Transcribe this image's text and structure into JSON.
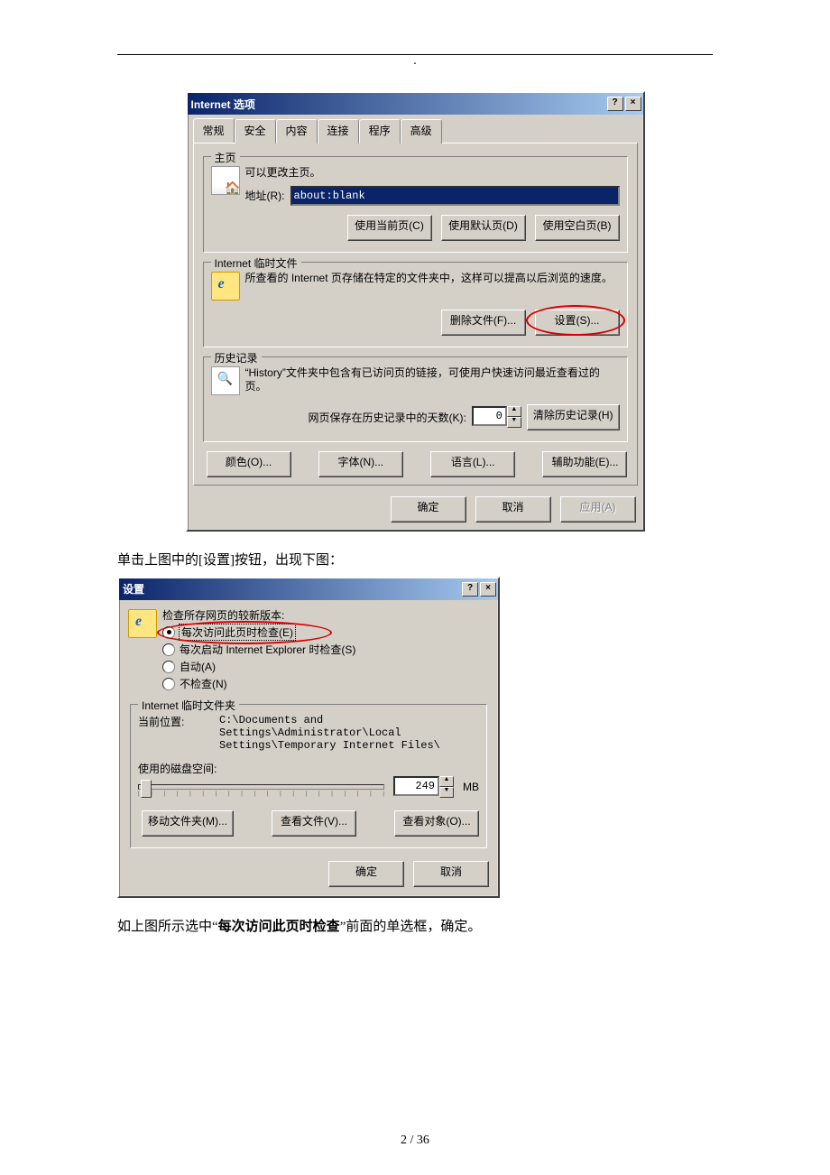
{
  "dialog1": {
    "title": "Internet 选项",
    "tabs": [
      "常规",
      "安全",
      "内容",
      "连接",
      "程序",
      "高级"
    ],
    "home": {
      "legend": "主页",
      "desc": "可以更改主页。",
      "address_label": "地址(R):",
      "address_value": "about:blank",
      "btn_current": "使用当前页(C)",
      "btn_default": "使用默认页(D)",
      "btn_blank": "使用空白页(B)"
    },
    "temp": {
      "legend": "Internet 临时文件",
      "desc": "所查看的 Internet 页存储在特定的文件夹中，这样可以提高以后浏览的速度。",
      "btn_delete": "删除文件(F)...",
      "btn_settings": "设置(S)..."
    },
    "history": {
      "legend": "历史记录",
      "desc": "“History”文件夹中包含有已访问页的链接，可使用户快速访问最近查看过的页。",
      "days_label": "网页保存在历史记录中的天数(K):",
      "days_value": "0",
      "btn_clear": "清除历史记录(H)"
    },
    "bottom_row": {
      "colors": "颜色(O)...",
      "fonts": "字体(N)...",
      "languages": "语言(L)...",
      "accessibility": "辅助功能(E)..."
    },
    "footer": {
      "ok": "确定",
      "cancel": "取消",
      "apply": "应用(A)"
    }
  },
  "caption1": "单击上图中的[设置]按钮，出现下图：",
  "dialog2": {
    "title": "设置",
    "check_group_label": "检查所存网页的较新版本:",
    "radios": {
      "r1": "每次访问此页时检查(E)",
      "r2": "每次启动 Internet Explorer 时检查(S)",
      "r3": "自动(A)",
      "r4": "不检查(N)"
    },
    "folder": {
      "legend": "Internet 临时文件夹",
      "loc_label": "当前位置:",
      "loc_value": "C:\\Documents and\nSettings\\Administrator\\Local\nSettings\\Temporary Internet Files\\",
      "disk_label": "使用的磁盘空间:",
      "disk_value": "249",
      "disk_unit": "MB",
      "btn_move": "移动文件夹(M)...",
      "btn_view_files": "查看文件(V)...",
      "btn_view_obj": "查看对象(O)..."
    },
    "footer": {
      "ok": "确定",
      "cancel": "取消"
    }
  },
  "caption2_pre": "如上图所示选中“",
  "caption2_bold": "每次访问此页时检查",
  "caption2_post": "”前面的单选框，确定。",
  "page_number": "2 / 36"
}
